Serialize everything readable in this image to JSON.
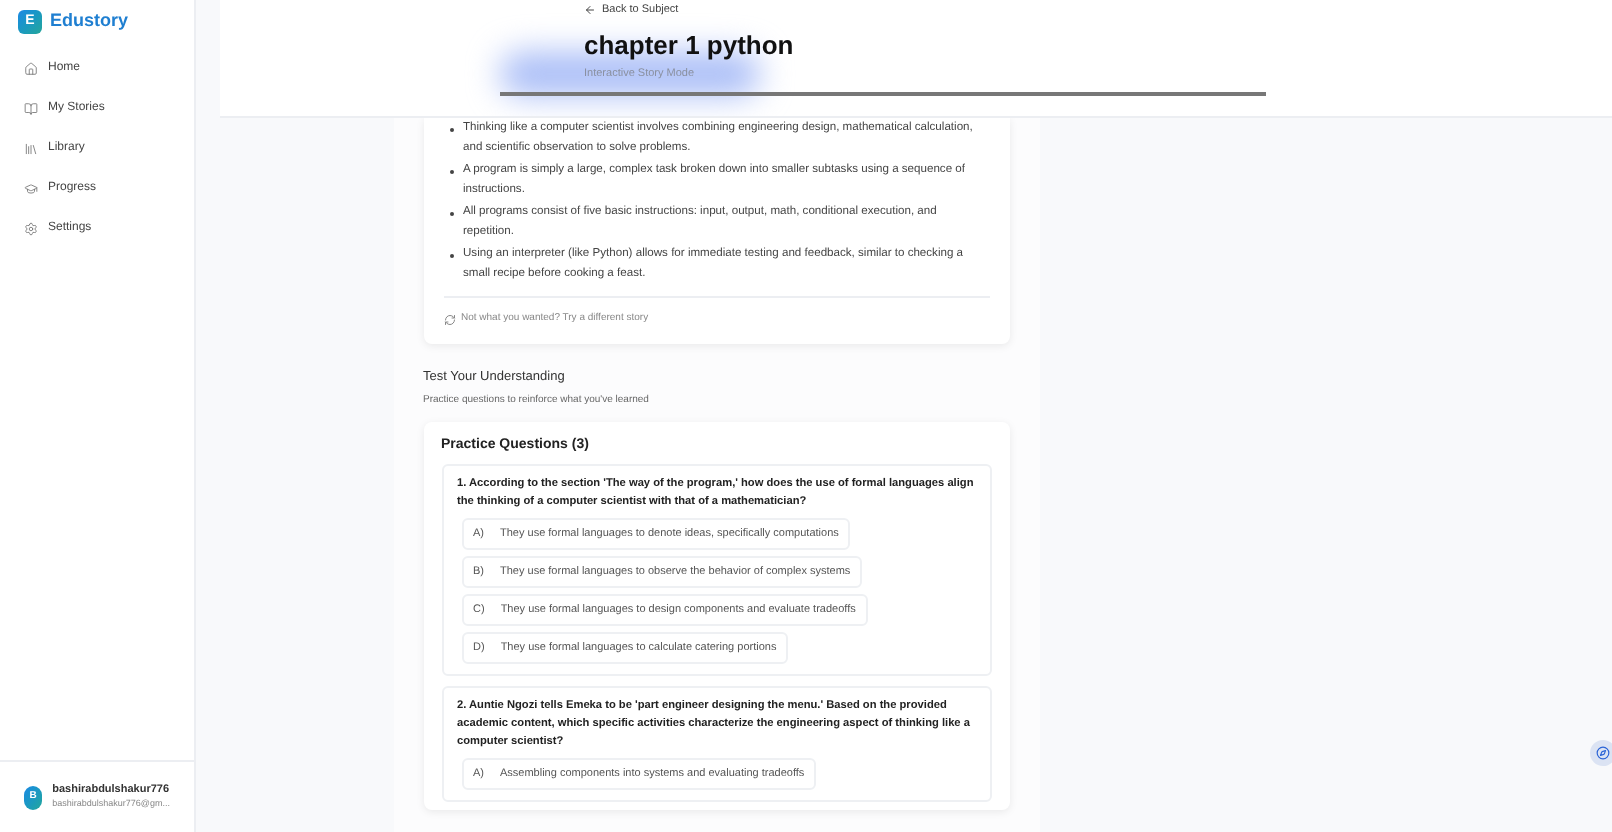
{
  "sidebar": {
    "brand": {
      "mark": "E",
      "name": "Edustory"
    },
    "items": [
      {
        "label": "Home"
      },
      {
        "label": "My Stories"
      },
      {
        "label": "Library"
      },
      {
        "label": "Progress"
      },
      {
        "label": "Settings"
      }
    ],
    "user": {
      "initial": "B",
      "name": "bashirabdulshakur776",
      "email": "bashirabdulshakur776@gm..."
    }
  },
  "header": {
    "back": "Back to Subject",
    "title": "chapter 1 python",
    "subtitle": "Interactive Story Mode"
  },
  "story": {
    "bullets": [
      "Thinking like a computer scientist involves combining engineering design, mathematical calculation, and scientific observation to solve problems.",
      "A program is simply a large, complex task broken down into smaller subtasks using a sequence of instructions.",
      "All programs consist of five basic instructions: input, output, math, conditional execution, and repetition.",
      "Using an interpreter (like Python) allows for immediate testing and feedback, similar to checking a small recipe before cooking a feast."
    ],
    "retry": "Not what you wanted? Try a different story"
  },
  "quiz": {
    "title": "Test Your Understanding",
    "subtitle": "Practice questions to reinforce what you've learned",
    "card_title": "Practice Questions (3)",
    "questions": [
      {
        "text": "1. According to the section 'The way of the program,' how does the use of formal languages align the thinking of a computer scientist with that of a mathematician?",
        "options": [
          {
            "letter": "A)",
            "text": "They use formal languages to denote ideas, specifically computations"
          },
          {
            "letter": "B)",
            "text": "They use formal languages to observe the behavior of complex systems"
          },
          {
            "letter": "C)",
            "text": "They use formal languages to design components and evaluate tradeoffs"
          },
          {
            "letter": "D)",
            "text": "They use formal languages to calculate catering portions"
          }
        ]
      },
      {
        "text": "2. Auntie Ngozi tells Emeka to be 'part engineer designing the menu.' Based on the provided academic content, which specific activities characterize the engineering aspect of thinking like a computer scientist?",
        "options": [
          {
            "letter": "A)",
            "text": "Assembling components into systems and evaluating tradeoffs"
          }
        ]
      }
    ]
  }
}
